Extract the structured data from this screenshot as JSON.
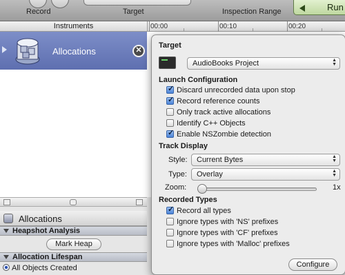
{
  "toolbar": {
    "record_label": "Record",
    "target_label": "Target",
    "inspection_range_label": "Inspection Range",
    "run_label": "Run"
  },
  "instruments_header": "Instruments",
  "timeline": {
    "tick_labels": [
      "00:00",
      "00:10",
      "00:20"
    ]
  },
  "instrument": {
    "name": "Allocations"
  },
  "detail_panel": {
    "title": "Allocations",
    "heapshot_section": "Heapshot Analysis",
    "mark_heap_button": "Mark Heap",
    "lifespan_section": "Allocation Lifespan",
    "lifespan_option": "All Objects Created"
  },
  "popover": {
    "target_heading": "Target",
    "target_value": "AudioBooks Project",
    "launch_heading": "Launch Configuration",
    "launch_options": [
      {
        "label": "Discard unrecorded data upon stop",
        "checked": true
      },
      {
        "label": "Record reference counts",
        "checked": true
      },
      {
        "label": "Only track active allocations",
        "checked": false
      },
      {
        "label": "Identify C++ Objects",
        "checked": false
      },
      {
        "label": "Enable NSZombie detection",
        "checked": true
      }
    ],
    "track_heading": "Track Display",
    "style_label": "Style:",
    "style_value": "Current Bytes",
    "type_label": "Type:",
    "type_value": "Overlay",
    "zoom_label": "Zoom:",
    "zoom_value_label": "1x",
    "zoom_level": 0,
    "recorded_heading": "Recorded Types",
    "recorded_options": [
      {
        "label": "Record all types",
        "checked": true
      },
      {
        "label": "Ignore types with 'NS' prefixes",
        "checked": false
      },
      {
        "label": "Ignore types with 'CF' prefixes",
        "checked": false
      },
      {
        "label": "Ignore types with 'Malloc' prefixes",
        "checked": false
      }
    ],
    "configure_button": "Configure"
  }
}
